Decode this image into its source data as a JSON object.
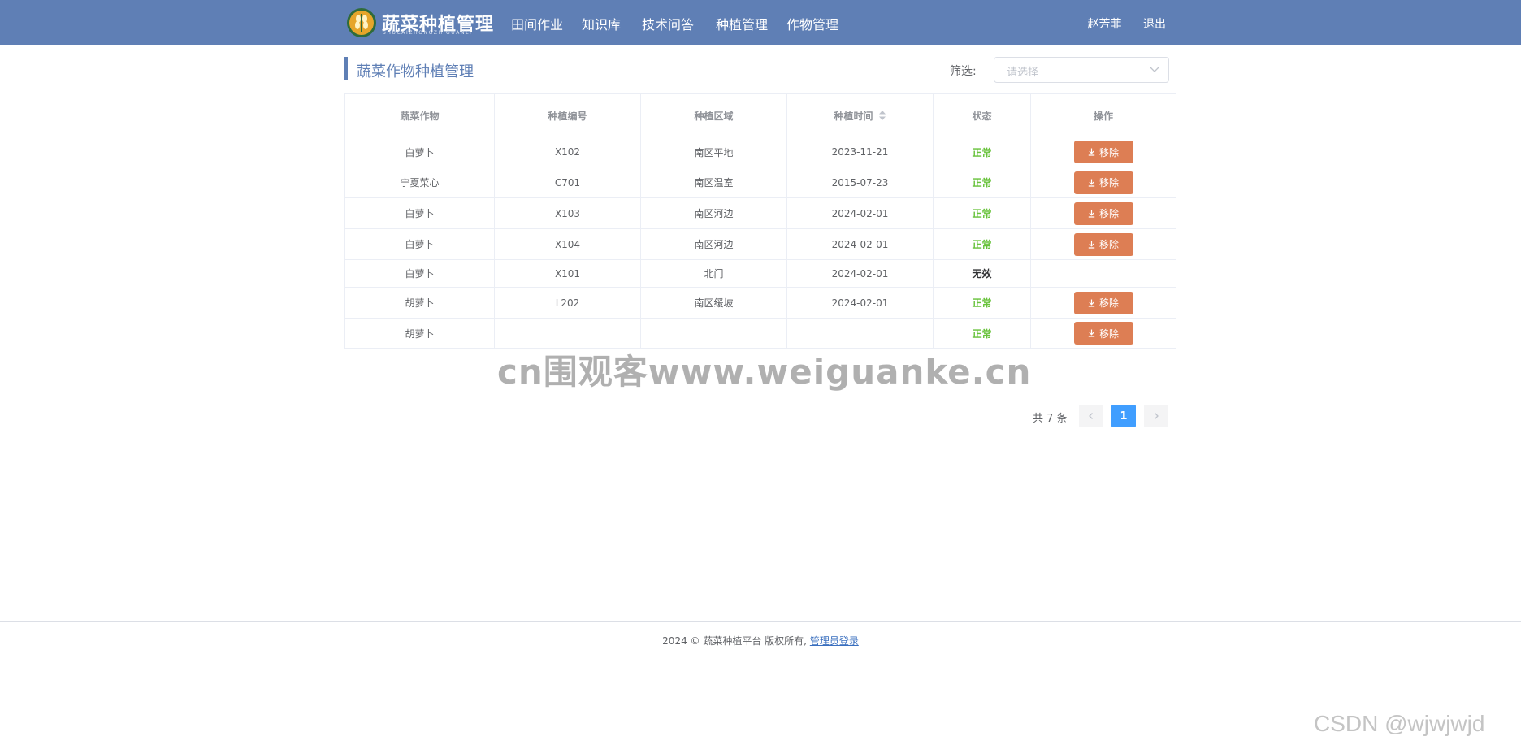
{
  "header": {
    "logo_title": "蔬菜种植管理",
    "logo_subtitle": "SHUCAIZHONGZHIGUANLI",
    "nav": [
      "田间作业",
      "知识库",
      "技术问答",
      "种植管理",
      "作物管理"
    ],
    "user_name": "赵芳菲",
    "logout": "退出"
  },
  "section": {
    "title": "蔬菜作物种植管理",
    "filter_label": "筛选:",
    "filter_placeholder": "请选择"
  },
  "table": {
    "columns": [
      "蔬菜作物",
      "种植编号",
      "种植区域",
      "种植时间",
      "状态",
      "操作"
    ],
    "action_label": "移除",
    "rows": [
      {
        "crop": "白萝卜",
        "code": "X102",
        "area": "南区平地",
        "date": "2023-11-21",
        "status": "正常",
        "has_action": true
      },
      {
        "crop": "宁夏菜心",
        "code": "C701",
        "area": "南区温室",
        "date": "2015-07-23",
        "status": "正常",
        "has_action": true
      },
      {
        "crop": "白萝卜",
        "code": "X103",
        "area": "南区河边",
        "date": "2024-02-01",
        "status": "正常",
        "has_action": true
      },
      {
        "crop": "白萝卜",
        "code": "X104",
        "area": "南区河边",
        "date": "2024-02-01",
        "status": "正常",
        "has_action": true
      },
      {
        "crop": "白萝卜",
        "code": "X101",
        "area": "北门",
        "date": "2024-02-01",
        "status": "无效",
        "has_action": false
      },
      {
        "crop": "胡萝卜",
        "code": "L202",
        "area": "南区缓坡",
        "date": "2024-02-01",
        "status": "正常",
        "has_action": true
      },
      {
        "crop": "胡萝卜",
        "code": "",
        "area": "",
        "date": "",
        "status": "正常",
        "has_action": true
      }
    ]
  },
  "pagination": {
    "total_text": "共 7 条",
    "current_page": "1"
  },
  "footer": {
    "text": "2024 © 蔬菜种植平台 版权所有,",
    "admin_link": "管理员登录"
  },
  "overlays": {
    "watermark": "cn围观客www.weiguanke.cn",
    "csdn": "CSDN @wjwjwjd"
  },
  "colors": {
    "header_bg": "#5f7fb5",
    "remove_button": "#dd7e54",
    "status_ok": "#67c23a",
    "pager_active": "#409eff"
  }
}
